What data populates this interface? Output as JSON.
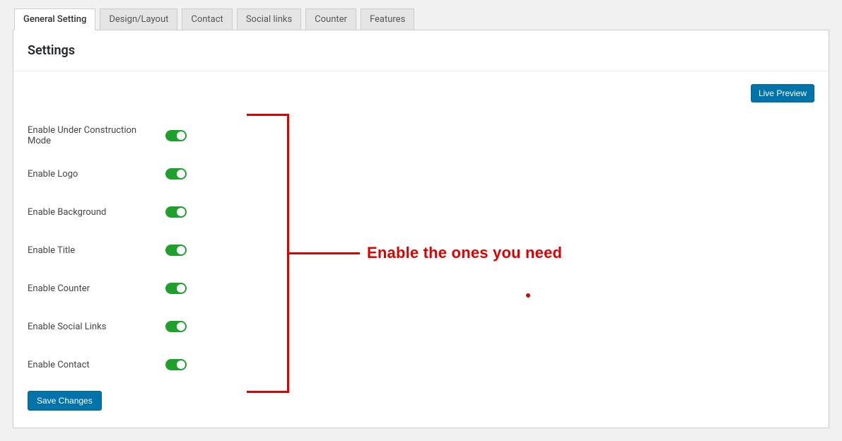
{
  "tabs": [
    {
      "label": "General Setting"
    },
    {
      "label": "Design/Layout"
    },
    {
      "label": "Contact"
    },
    {
      "label": "Social links"
    },
    {
      "label": "Counter"
    },
    {
      "label": "Features"
    }
  ],
  "panel": {
    "title": "Settings",
    "live_preview_label": "Live Preview",
    "save_button_label": "Save Changes"
  },
  "settings": [
    {
      "label": "Enable Under Construction Mode",
      "value": true
    },
    {
      "label": "Enable Logo",
      "value": true
    },
    {
      "label": "Enable Background",
      "value": true
    },
    {
      "label": "Enable Title",
      "value": true
    },
    {
      "label": "Enable Counter",
      "value": true
    },
    {
      "label": "Enable Social Links",
      "value": true
    },
    {
      "label": "Enable Contact",
      "value": true
    }
  ],
  "annotation": {
    "text": "Enable the ones you need"
  }
}
